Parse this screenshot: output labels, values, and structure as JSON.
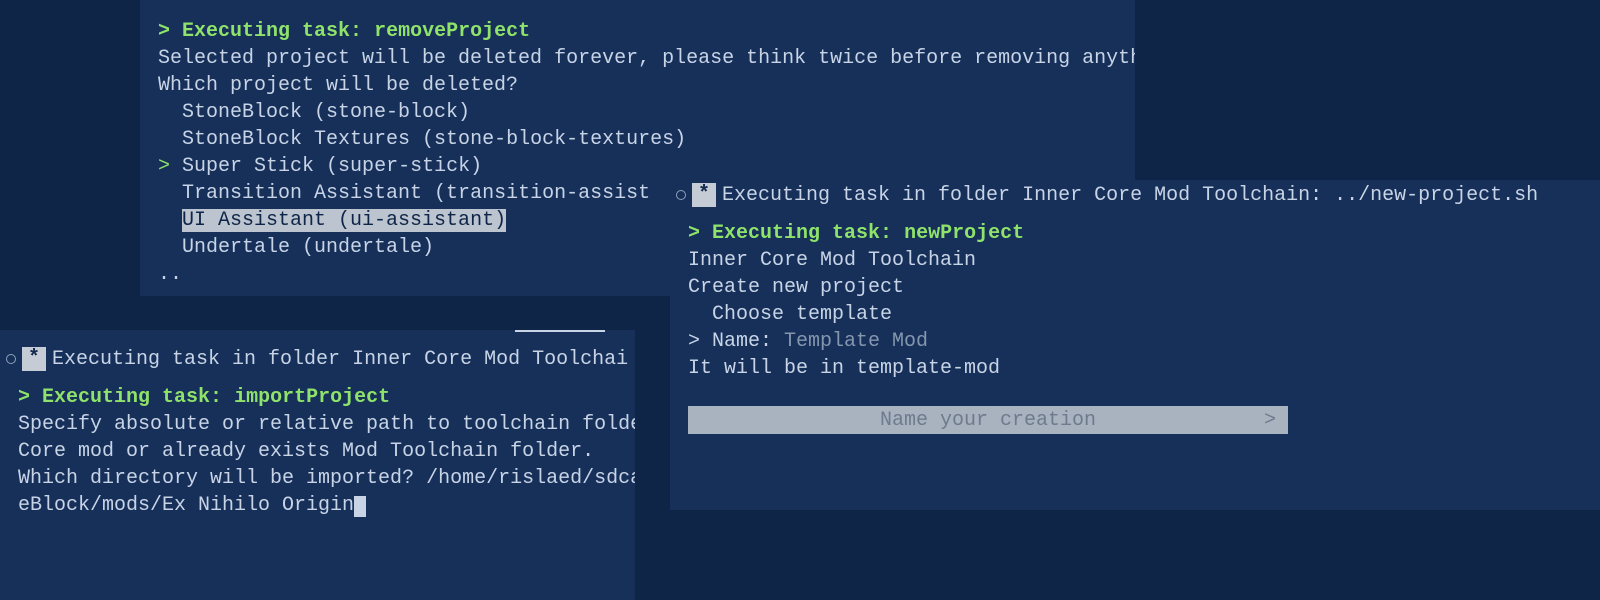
{
  "removeProject": {
    "task_prefix": "> ",
    "task_label": "Executing task:",
    "task_name": "removeProject",
    "warning": "Selected project will be deleted forever, please think twice before removing anything!",
    "question": "Which project will be deleted?",
    "items": [
      {
        "label": "StoneBlock (stone-block)",
        "selected": false,
        "highlighted": false
      },
      {
        "label": "StoneBlock Textures (stone-block-textures)",
        "selected": false,
        "highlighted": false
      },
      {
        "label": "Super Stick (super-stick)",
        "selected": true,
        "highlighted": false
      },
      {
        "label": "Transition Assistant (transition-assist",
        "selected": false,
        "highlighted": false
      },
      {
        "label": "UI Assistant (ui-assistant)",
        "selected": false,
        "highlighted": true
      },
      {
        "label": "Undertale (undertale)",
        "selected": false,
        "highlighted": false
      }
    ],
    "dots": ".."
  },
  "importProject": {
    "bar_text": "Executing task in folder Inner Core Mod Toolchai",
    "task_label": "Executing task:",
    "task_name": "importProject",
    "line1": "Specify absolute or relative path to toolchain folde",
    "line2": "Core mod or already exists Mod Toolchain folder.",
    "question": "Which directory will be imported? ",
    "path": "/home/rislaed/sdca",
    "path2": "eBlock/mods/Ex Nihilo Origin"
  },
  "newProject": {
    "bar_text": "Executing task in folder Inner Core Mod Toolchain: ../new-project.sh",
    "task_label": "Executing task:",
    "task_name": "newProject",
    "line1": "Inner Core Mod Toolchain",
    "line2": "Create new project",
    "choose": "  Choose template",
    "name_prompt": "> Name: ",
    "name_value": "Template Mod",
    "dir_line": "It will be in template-mod",
    "input_placeholder": "Name your creation",
    "input_arrow": ">"
  }
}
